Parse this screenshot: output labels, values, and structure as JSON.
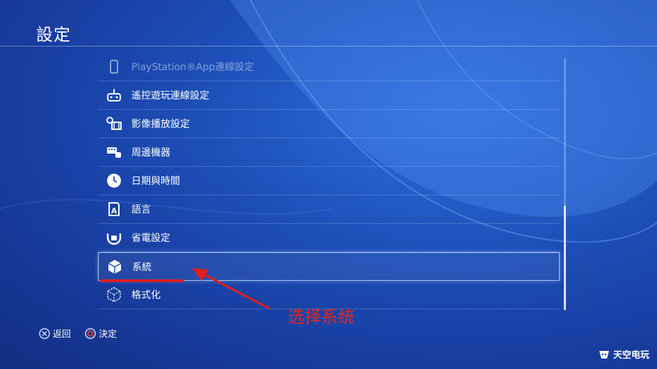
{
  "header": {
    "title": "設定"
  },
  "menu": {
    "items": [
      {
        "label": "PlayStation®App連線設定",
        "icon": "smartphone-icon",
        "state": "faded"
      },
      {
        "label": "遙控遊玩連線設定",
        "icon": "remote-play-icon",
        "state": "normal"
      },
      {
        "label": "影像播放設定",
        "icon": "video-playback-icon",
        "state": "normal"
      },
      {
        "label": "周邊機器",
        "icon": "peripherals-icon",
        "state": "normal"
      },
      {
        "label": "日期與時間",
        "icon": "clock-icon",
        "state": "normal"
      },
      {
        "label": "語言",
        "icon": "language-icon",
        "state": "normal"
      },
      {
        "label": "省電設定",
        "icon": "power-save-icon",
        "state": "normal"
      },
      {
        "label": "系統",
        "icon": "system-cube-icon",
        "state": "selected"
      },
      {
        "label": "格式化",
        "icon": "initialize-icon",
        "state": "normal"
      }
    ]
  },
  "annotation": {
    "text": "选择系统",
    "color": "#e5261c"
  },
  "footer": {
    "back_label": "返回",
    "confirm_label": "決定"
  },
  "watermark": {
    "text": "天空电玩"
  },
  "colors": {
    "background": "#1d4fb8",
    "selection_border": "#bed7ff",
    "annotation_red": "#e01e1e"
  }
}
